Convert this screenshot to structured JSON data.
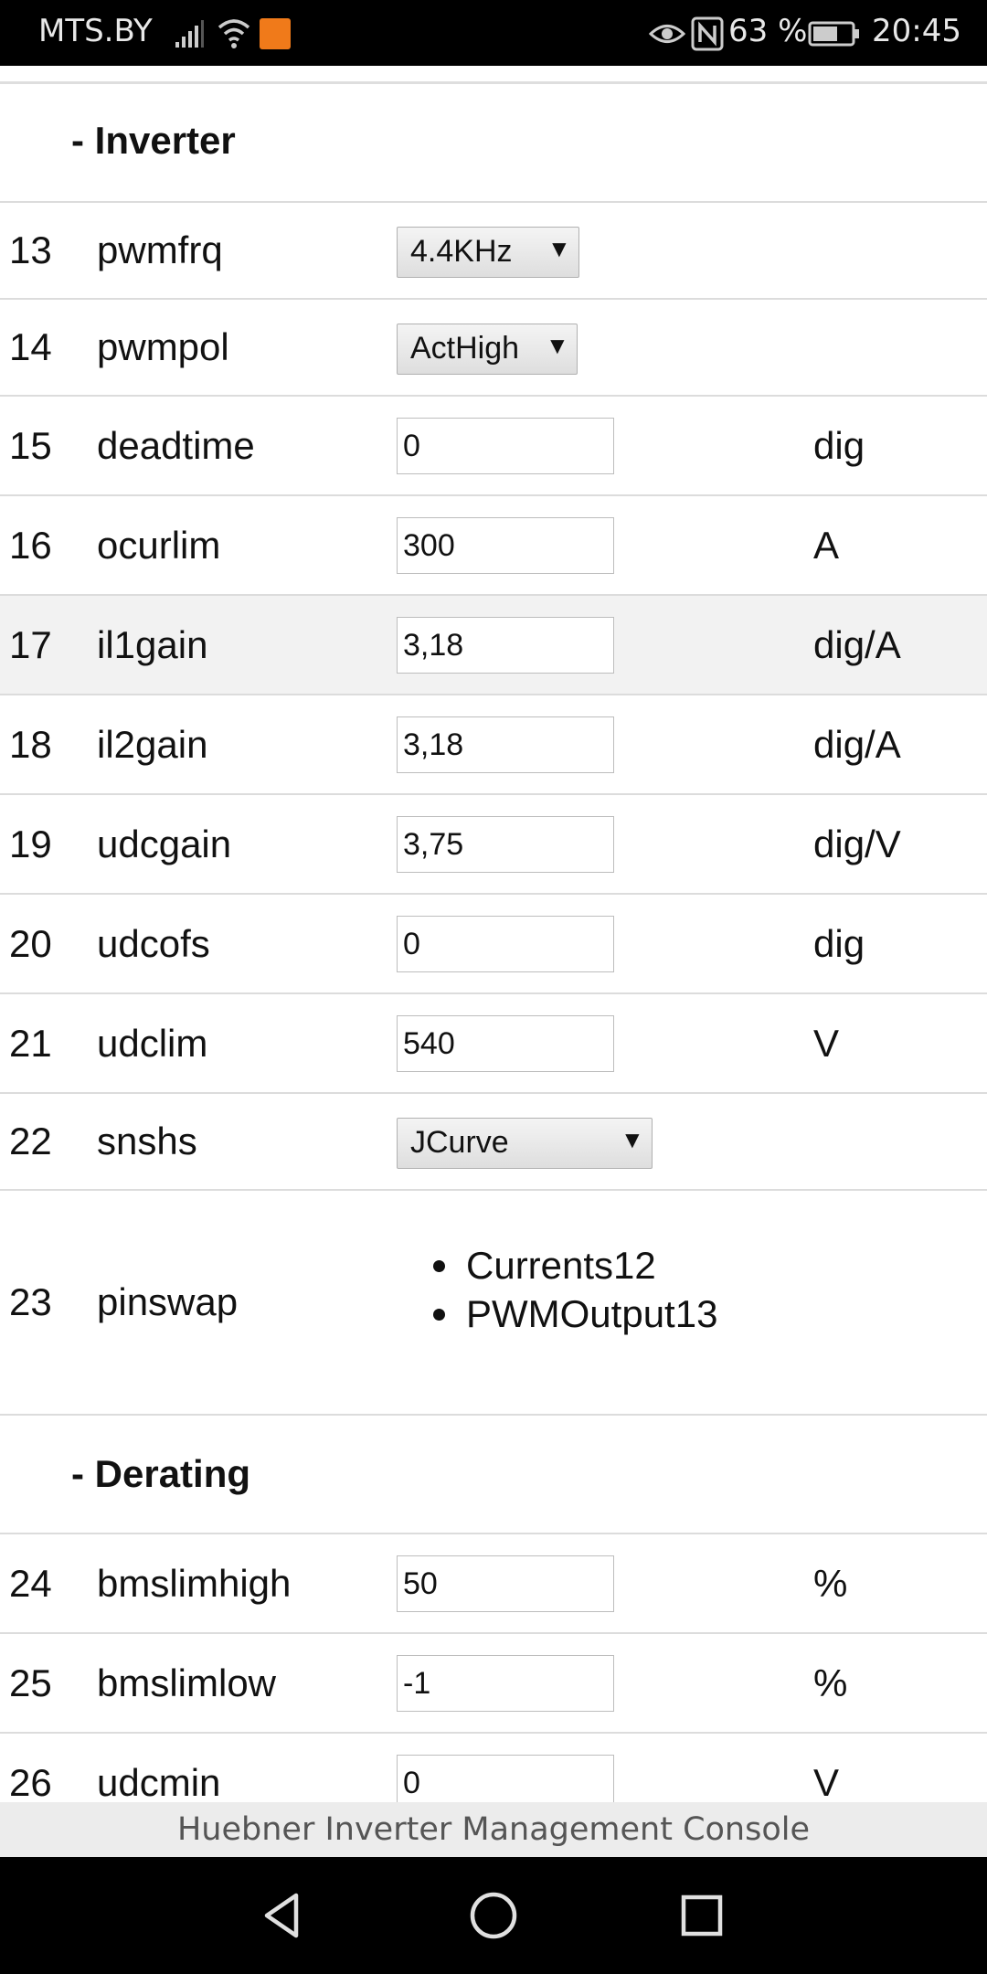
{
  "status_bar": {
    "carrier": "MTS.BY",
    "battery_percent": "63 %",
    "time": "20:45",
    "icons": [
      "signal-icon",
      "wifi-icon",
      "app-notification-icon",
      "eye-icon",
      "nfc-icon",
      "battery-icon"
    ]
  },
  "sections": {
    "inverter": "- Inverter",
    "derating": "- Derating"
  },
  "params": [
    {
      "num": "13",
      "name": "pwmfrq",
      "type": "select",
      "value": "4.4KHz",
      "unit": ""
    },
    {
      "num": "14",
      "name": "pwmpol",
      "type": "select",
      "value": "ActHigh",
      "unit": ""
    },
    {
      "num": "15",
      "name": "deadtime",
      "type": "input",
      "value": "0",
      "unit": "dig"
    },
    {
      "num": "16",
      "name": "ocurlim",
      "type": "input",
      "value": "300",
      "unit": "A"
    },
    {
      "num": "17",
      "name": "il1gain",
      "type": "input",
      "value": "3,18",
      "unit": "dig/A"
    },
    {
      "num": "18",
      "name": "il2gain",
      "type": "input",
      "value": "3,18",
      "unit": "dig/A"
    },
    {
      "num": "19",
      "name": "udcgain",
      "type": "input",
      "value": "3,75",
      "unit": "dig/V"
    },
    {
      "num": "20",
      "name": "udcofs",
      "type": "input",
      "value": "0",
      "unit": "dig"
    },
    {
      "num": "21",
      "name": "udclim",
      "type": "input",
      "value": "540",
      "unit": "V"
    },
    {
      "num": "22",
      "name": "snshs",
      "type": "select",
      "value": "JCurve",
      "unit": ""
    },
    {
      "num": "23",
      "name": "pinswap",
      "type": "list",
      "items": [
        "Currents12",
        "PWMOutput13"
      ],
      "unit": ""
    },
    {
      "num": "24",
      "name": "bmslimhigh",
      "type": "input",
      "value": "50",
      "unit": "%"
    },
    {
      "num": "25",
      "name": "bmslimlow",
      "type": "input",
      "value": "-1",
      "unit": "%"
    },
    {
      "num": "26",
      "name": "udcmin",
      "type": "input",
      "value": "0",
      "unit": "V"
    }
  ],
  "footer": "Huebner Inverter Management Console",
  "nav_bar": [
    "back-icon",
    "home-icon",
    "recents-icon"
  ]
}
